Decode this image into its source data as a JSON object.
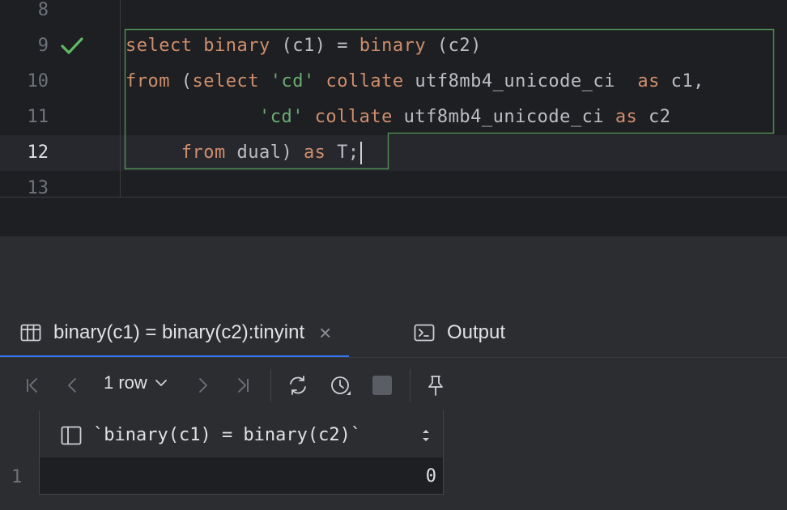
{
  "editor": {
    "line_numbers": [
      "8",
      "9",
      "10",
      "11",
      "12",
      "13"
    ],
    "lines": [
      {
        "kw1": "select",
        "t1": " ",
        "kw2": "binary",
        "t2": " (c1) = ",
        "kw3": "binary",
        "t3": " (c2)"
      },
      {
        "kw1": "from",
        "t1": " (",
        "kw2": "select",
        "t2": " ",
        "s1": "'cd'",
        "t3": " ",
        "kw3": "collate",
        "t4": " utf8mb4_unicode_ci  ",
        "kw4": "as",
        "t5": " c1,"
      },
      {
        "t0": "            ",
        "s1": "'cd'",
        "t1": " ",
        "kw1": "collate",
        "t2": " utf8mb4_unicode_ci ",
        "kw2": "as",
        "t3": " c2"
      },
      {
        "t0": "     ",
        "kw1": "from",
        "t1": " dual) ",
        "kw2": "as",
        "t2": " T;"
      }
    ],
    "status_icon": "checkmark-icon"
  },
  "results": {
    "tabs": [
      {
        "label": "binary(c1) = binary(c2):tinyint",
        "icon": "table-icon",
        "active": true
      },
      {
        "label": "Output",
        "icon": "console-icon",
        "active": false
      }
    ],
    "toolbar": {
      "rows_label": "1 row",
      "icons": [
        "first-page-icon",
        "prev-page-icon",
        "next-page-icon",
        "last-page-icon",
        "reload-icon",
        "history-icon",
        "stop-icon",
        "pin-icon"
      ]
    },
    "grid": {
      "columns": [
        "`binary(c1) = binary(c2)`"
      ],
      "rows": [
        {
          "num": "1",
          "cells": [
            "0"
          ]
        }
      ]
    }
  },
  "colors": {
    "keyword": "#cf8e6d",
    "string": "#6aab73",
    "success": "#5fb865",
    "accent": "#3574f0",
    "background": "#1e1f22",
    "panel": "#2b2d30"
  }
}
